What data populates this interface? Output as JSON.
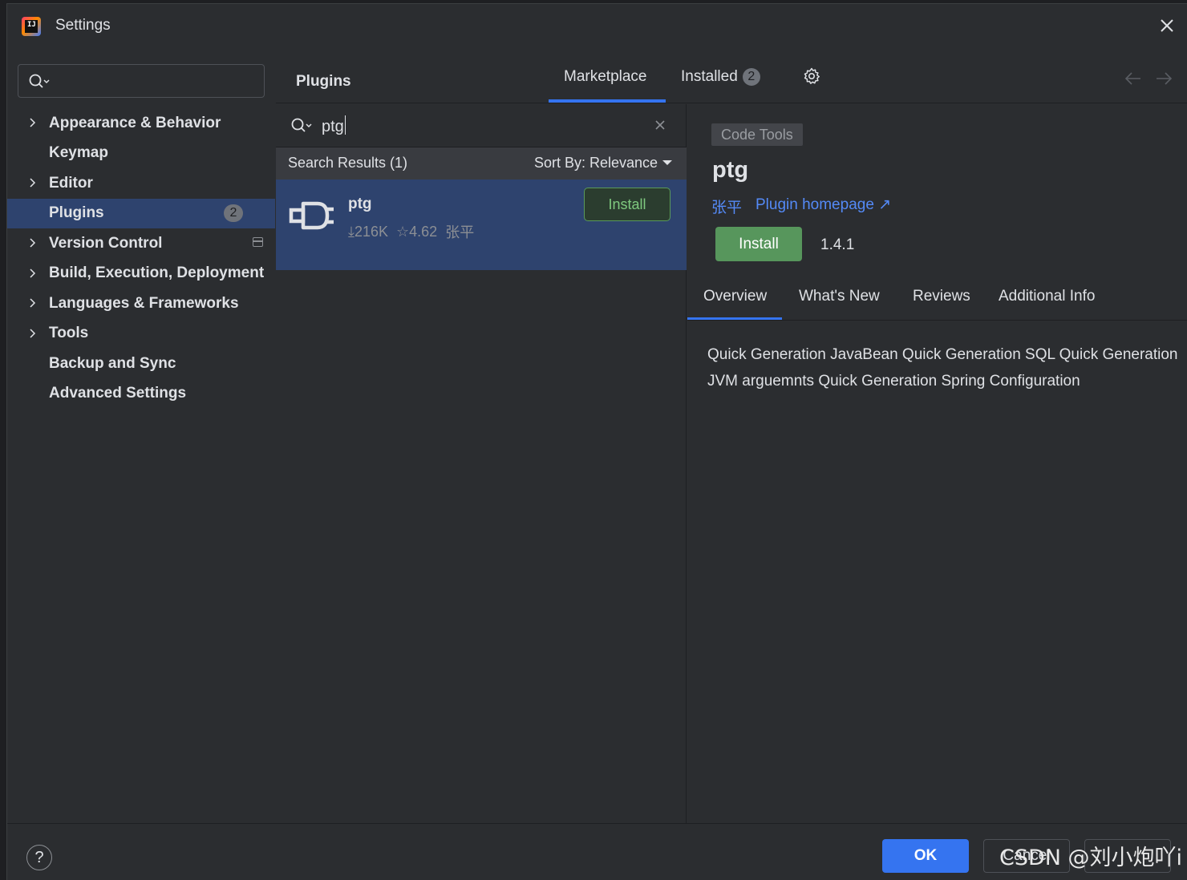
{
  "window": {
    "title": "Settings"
  },
  "sidebar": {
    "search_placeholder": "",
    "items": [
      {
        "label": "Appearance & Behavior",
        "expandable": true
      },
      {
        "label": "Keymap",
        "expandable": false
      },
      {
        "label": "Editor",
        "expandable": true
      },
      {
        "label": "Plugins",
        "expandable": false,
        "selected": true,
        "badge": "2"
      },
      {
        "label": "Version Control",
        "expandable": true
      },
      {
        "label": "Build, Execution, Deployment",
        "expandable": true
      },
      {
        "label": "Languages & Frameworks",
        "expandable": true
      },
      {
        "label": "Tools",
        "expandable": true
      },
      {
        "label": "Backup and Sync",
        "expandable": false
      },
      {
        "label": "Advanced Settings",
        "expandable": false
      }
    ]
  },
  "plugins_header": {
    "title": "Plugins",
    "tabs": [
      {
        "label": "Marketplace",
        "active": true
      },
      {
        "label": "Installed",
        "badge": "2"
      }
    ]
  },
  "search": {
    "value": "ptg"
  },
  "results": {
    "label": "Search Results (1)",
    "sort_label": "Sort By: Relevance",
    "items": [
      {
        "name": "ptg",
        "downloads": "216K",
        "rating": "4.62",
        "vendor": "张平",
        "install_label": "Install"
      }
    ]
  },
  "detail": {
    "tag": "Code Tools",
    "name": "ptg",
    "vendor": "张平",
    "homepage_label": "Plugin homepage ↗",
    "install_label": "Install",
    "version": "1.4.1",
    "tabs": [
      "Overview",
      "What's New",
      "Reviews",
      "Additional Info"
    ],
    "description": "Quick Generation JavaBean Quick Generation SQL Quick Generation JVM arguemnts Quick Generation Spring Configuration"
  },
  "footer": {
    "help_label": "?",
    "ok_label": "OK",
    "cancel_label": "Cancel"
  },
  "watermark": "CSDN @刘小炮吖i",
  "colors": {
    "background": "#2b2d30",
    "accent": "#3574f0",
    "selection": "#2e436e",
    "install_green": "#57965c",
    "link": "#548af7"
  }
}
